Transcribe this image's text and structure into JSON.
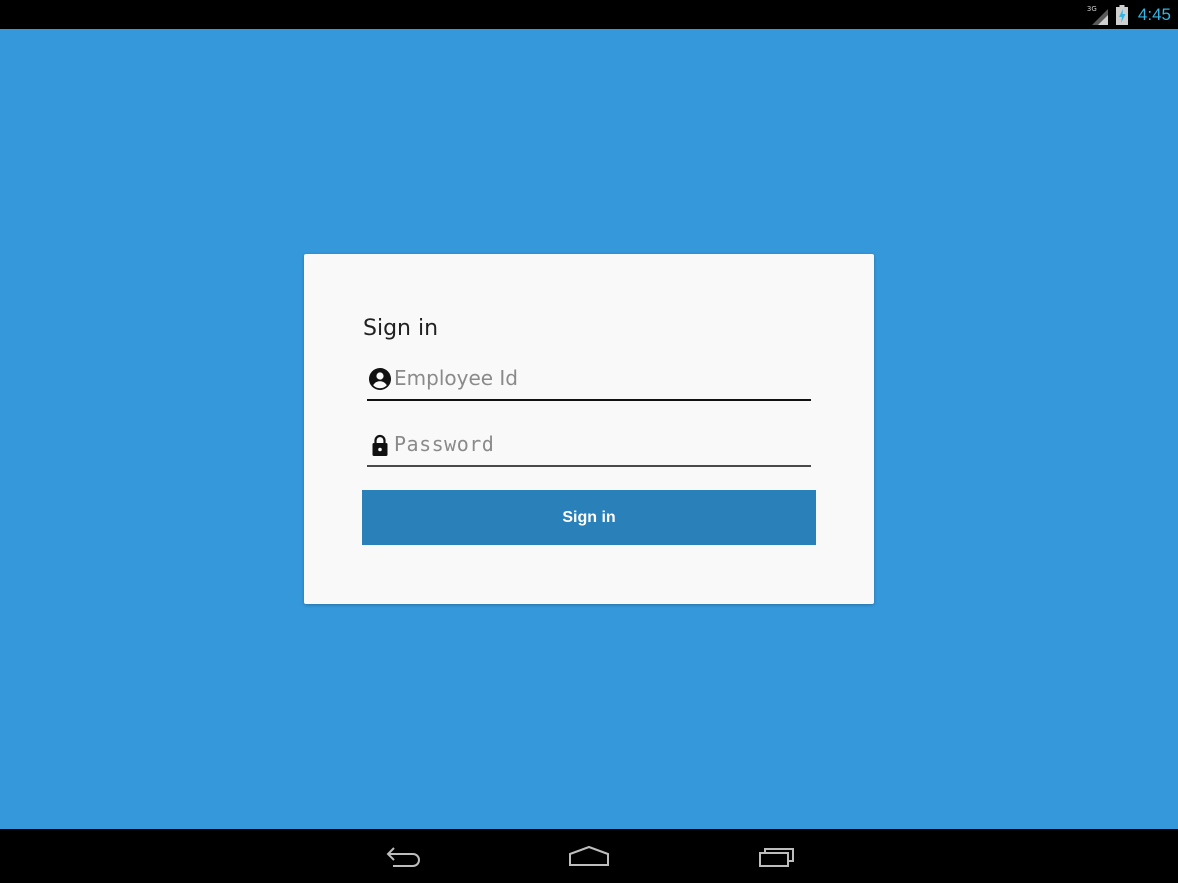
{
  "status_bar": {
    "network_label": "3G",
    "signal_icon": "signal-icon",
    "battery_icon": "battery-charging-icon",
    "time": "4:45",
    "clock_color": "#33b5e5"
  },
  "colors": {
    "background": "#3598db",
    "card": "#f9f9f9",
    "button": "#2a80b9",
    "button_text": "#ffffff"
  },
  "login": {
    "title": "Sign in",
    "employee_id": {
      "icon": "account-circle-icon",
      "placeholder": "Employee Id",
      "value": ""
    },
    "password": {
      "icon": "lock-icon",
      "placeholder": "Password",
      "value": ""
    },
    "submit_label": "Sign in"
  },
  "nav_bar": {
    "back_icon": "back-icon",
    "home_icon": "home-icon",
    "recents_icon": "recent-apps-icon"
  }
}
